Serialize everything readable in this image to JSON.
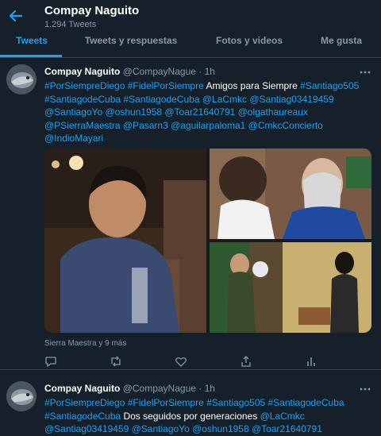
{
  "header": {
    "name": "Compay Naguito",
    "tweet_count": "1.294 Tweets"
  },
  "tabs": [
    {
      "label": "Tweets",
      "active": true
    },
    {
      "label": "Tweets y respuestas",
      "active": false
    },
    {
      "label": "Fotos y videos",
      "active": false
    },
    {
      "label": "Me gusta",
      "active": false
    }
  ],
  "tweets": [
    {
      "author": "Compay Naguito",
      "handle": "@CompayNague",
      "separator": "·",
      "time": "1h",
      "line1_tags": "#PorSiempreDiego #FidelPorSiempre",
      "line1_text": "Amigos para Siempre",
      "line1_tag_end": "#Santiago505",
      "line2": "#SantiagodeCuba #SantiagodeCuba @LaCmkc @Santiag03419459",
      "line3": "@SantiagoYo @oshun1958 @Toar21640791 @olgathaureaux",
      "line4": "@PSierraMaestra @Pasarn3 @aguilarpaloma1 @CmkcConcierto",
      "line5": "@IndioMayari",
      "location": "Sierra Maestra y 9 más"
    },
    {
      "author": "Compay Naguito",
      "handle": "@CompayNague",
      "separator": "·",
      "time": "1h",
      "line1": "#PorSiempreDiego #FidelPorSiempre #Santiago505 #SantiagodeCuba",
      "line2_tag": "#SantiagodeCuba",
      "line2_text": "Dos seguidos por generaciones",
      "line2_tag_end": "@LaCmkc",
      "line3": "@Santiag03419459 @SantiagoYo @oshun1958 @Toar21640791"
    }
  ],
  "colors": {
    "background": "#15202b",
    "accent": "#1da1f2",
    "muted": "#8899a6",
    "divider": "#38444d"
  },
  "icons": {
    "back": "arrow-left-icon",
    "more": "more-horizontal-icon",
    "reply": "reply-icon",
    "retweet": "retweet-icon",
    "like": "heart-icon",
    "share": "share-icon",
    "stats": "analytics-icon"
  }
}
